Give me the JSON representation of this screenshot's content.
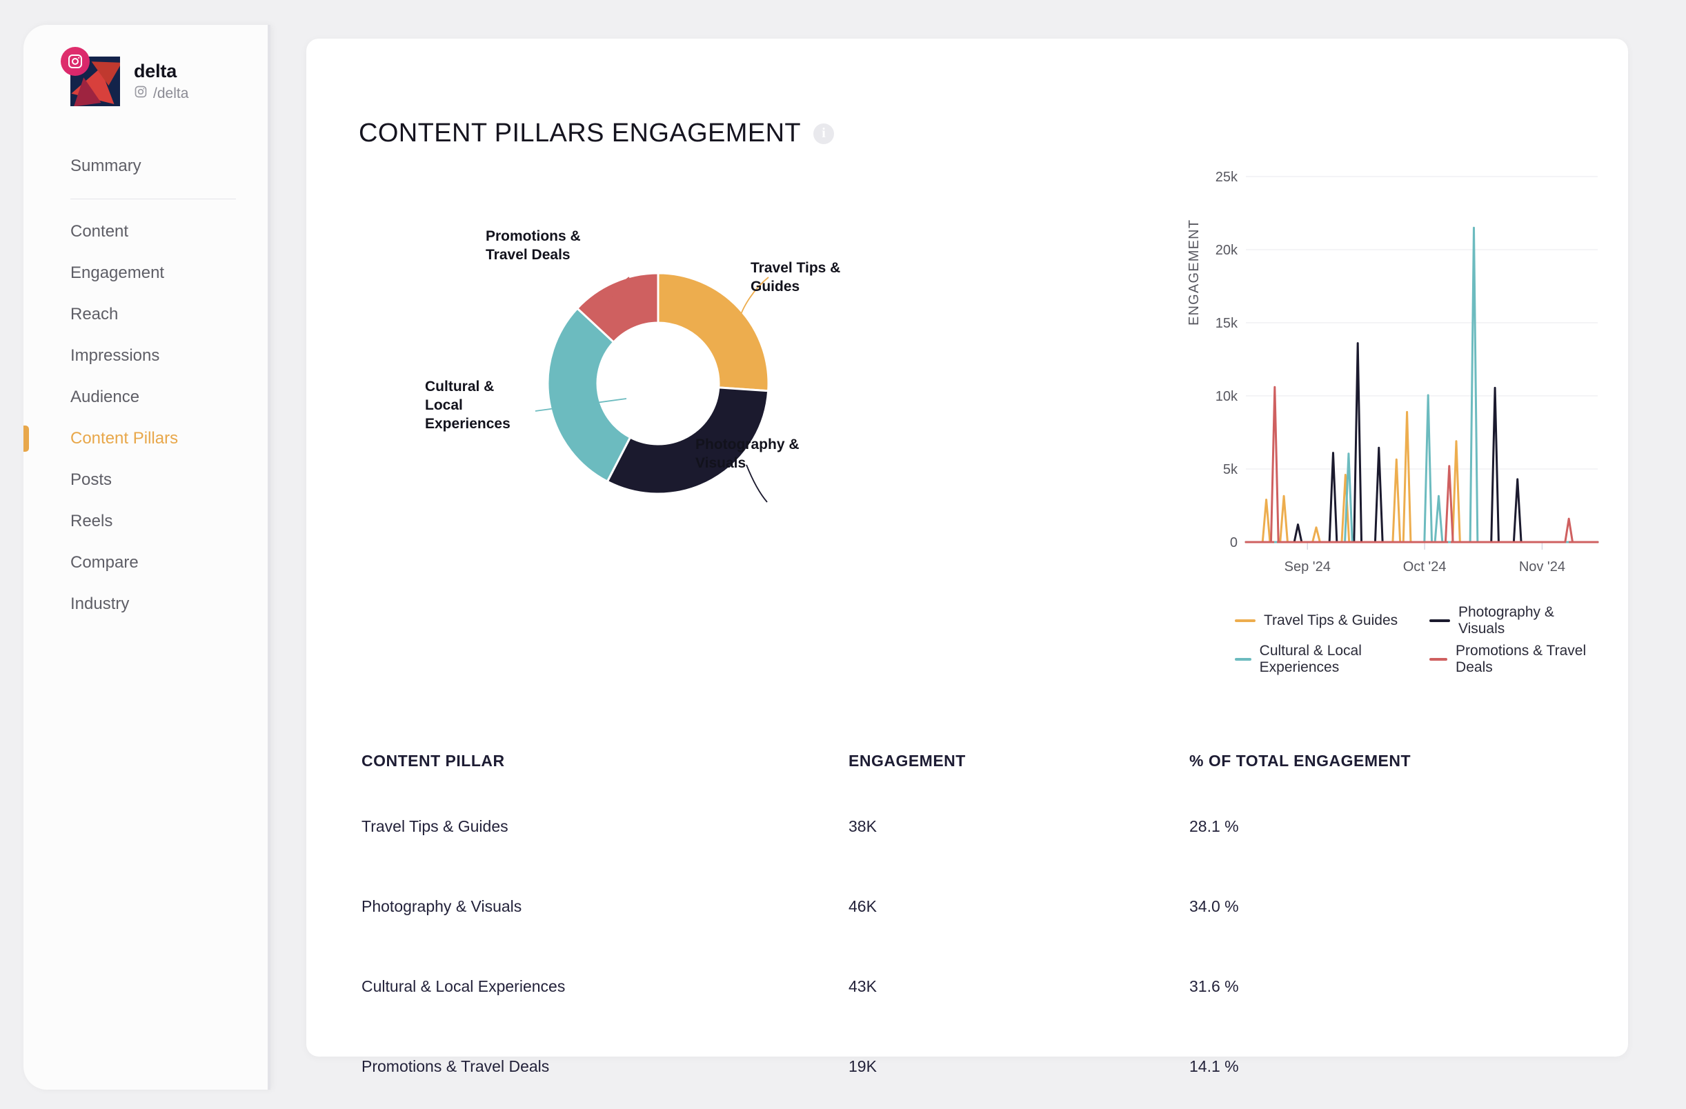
{
  "sidebar": {
    "account": {
      "name": "delta",
      "handle": "/delta",
      "platform_icon": "instagram-icon",
      "badge_icon": "instagram-badge-icon"
    },
    "items": [
      {
        "label": "Summary",
        "active": false
      },
      {
        "label": "Content",
        "active": false
      },
      {
        "label": "Engagement",
        "active": false
      },
      {
        "label": "Reach",
        "active": false
      },
      {
        "label": "Impressions",
        "active": false
      },
      {
        "label": "Audience",
        "active": false
      },
      {
        "label": "Content Pillars",
        "active": true
      },
      {
        "label": "Posts",
        "active": false
      },
      {
        "label": "Reels",
        "active": false
      },
      {
        "label": "Compare",
        "active": false
      },
      {
        "label": "Industry",
        "active": false
      }
    ]
  },
  "header": {
    "title": "CONTENT PILLARS ENGAGEMENT",
    "info_icon": "info-icon",
    "info_glyph": "i"
  },
  "colors": {
    "travel_tips": "#EDAD4E",
    "photography": "#1B1A2E",
    "cultural": "#6CBBBF",
    "promotions": "#CF6060",
    "accent": "#E8A74A",
    "grid": "#EEEEF1",
    "axis_text": "#57575F"
  },
  "chart_data": [
    {
      "type": "pie",
      "title": "",
      "labels": [
        "Travel Tips & Guides",
        "Photography & Visuals",
        "Cultural & Local Experiences",
        "Promotions & Travel Deals"
      ],
      "values": [
        28.1,
        34.0,
        31.6,
        14.1
      ],
      "colors": [
        "#EDAD4E",
        "#1B1A2E",
        "#6CBBBF",
        "#CF6060"
      ],
      "donut": true,
      "inner_radius_ratio": 0.55,
      "start_angle_deg": 0,
      "legend": "callout-labels"
    },
    {
      "type": "line",
      "title": "",
      "xlabel": "",
      "ylabel": "ENGAGEMENT",
      "ylim": [
        0,
        25000
      ],
      "yticks": [
        0,
        5000,
        10000,
        15000,
        20000,
        25000
      ],
      "ytick_labels": [
        "0",
        "5k",
        "10k",
        "15k",
        "20k",
        "25k"
      ],
      "xticks": [
        "Sep '24",
        "Oct '24",
        "Nov '24"
      ],
      "xtick_positions": [
        0.175,
        0.508,
        0.842
      ],
      "grid": true,
      "legend_position": "bottom",
      "series": [
        {
          "name": "Travel Tips & Guides",
          "color": "#EDAD4E",
          "spikes": [
            {
              "x": 0.058,
              "y": 2900
            },
            {
              "x": 0.108,
              "y": 3150
            },
            {
              "x": 0.2,
              "y": 1000
            },
            {
              "x": 0.283,
              "y": 4600
            },
            {
              "x": 0.428,
              "y": 5650
            },
            {
              "x": 0.458,
              "y": 8900
            },
            {
              "x": 0.598,
              "y": 6900
            }
          ]
        },
        {
          "name": "Photography & Visuals",
          "color": "#1B1A2E",
          "spikes": [
            {
              "x": 0.148,
              "y": 1200
            },
            {
              "x": 0.248,
              "y": 6100
            },
            {
              "x": 0.318,
              "y": 13600
            },
            {
              "x": 0.378,
              "y": 6450
            },
            {
              "x": 0.708,
              "y": 10550
            },
            {
              "x": 0.772,
              "y": 4300
            }
          ]
        },
        {
          "name": "Cultural & Local Experiences",
          "color": "#6CBBBF",
          "spikes": [
            {
              "x": 0.292,
              "y": 6050
            },
            {
              "x": 0.518,
              "y": 10050
            },
            {
              "x": 0.548,
              "y": 3150
            },
            {
              "x": 0.648,
              "y": 21500
            }
          ]
        },
        {
          "name": "Promotions & Travel Deals",
          "color": "#CF6060",
          "spikes": [
            {
              "x": 0.082,
              "y": 10600
            },
            {
              "x": 0.578,
              "y": 5200
            },
            {
              "x": 0.918,
              "y": 1600
            }
          ]
        }
      ]
    }
  ],
  "donut_callouts": [
    {
      "id": "promotions",
      "label": "Promotions &\nTravel Deals"
    },
    {
      "id": "travel",
      "label": "Travel Tips &\nGuides"
    },
    {
      "id": "cultural",
      "label": "Cultural &\nLocal\nExperiences"
    },
    {
      "id": "photography",
      "label": "Photography &\nVisuals"
    }
  ],
  "table": {
    "headers": [
      "CONTENT PILLAR",
      "ENGAGEMENT",
      "% OF TOTAL ENGAGEMENT"
    ],
    "rows": [
      {
        "pillar": "Travel Tips & Guides",
        "engagement": "38K",
        "pct": "28.1 %"
      },
      {
        "pillar": "Photography & Visuals",
        "engagement": "46K",
        "pct": "34.0 %"
      },
      {
        "pillar": "Cultural & Local Experiences",
        "engagement": "43K",
        "pct": "31.6 %"
      },
      {
        "pillar": "Promotions & Travel Deals",
        "engagement": "19K",
        "pct": "14.1 %"
      }
    ]
  }
}
